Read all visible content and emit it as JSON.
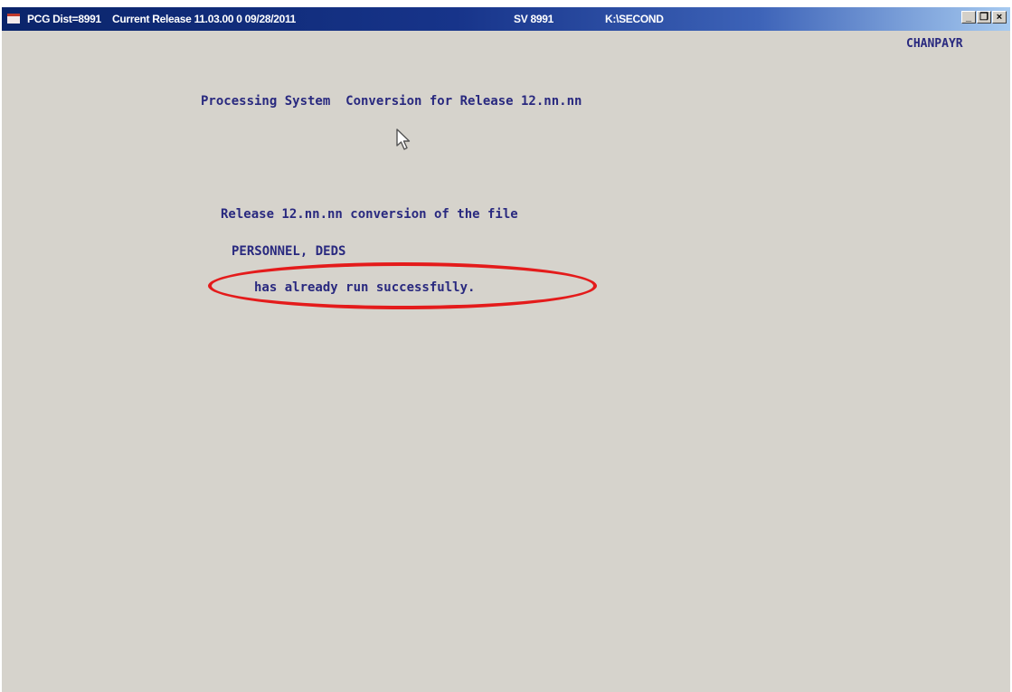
{
  "titlebar": {
    "dist": "PCG Dist=8991",
    "release": "Current Release 11.03.00  0  09/28/2011",
    "sv": "SV 8991",
    "path": "K:\\SECOND",
    "minimize": "_",
    "restore": "❐",
    "close": "×"
  },
  "terminal": {
    "user": "CHANPAYR",
    "heading": "Processing System  Conversion for Release 12.nn.nn",
    "line1": "Release 12.nn.nn conversion of the file",
    "line2": "PERSONNEL, DEDS",
    "line3": "has already run successfully."
  },
  "colors": {
    "terminal_bg": "#d6d3cc",
    "terminal_text": "#29297f",
    "highlight": "#e41b1b",
    "titlebar": "#0a246a"
  },
  "icons": {
    "app": "app-icon",
    "cursor": "mouse-pointer-icon"
  }
}
